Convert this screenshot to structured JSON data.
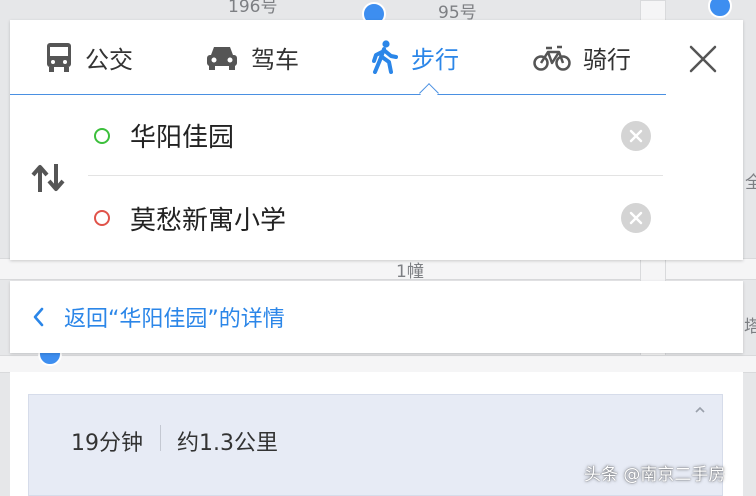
{
  "map": {
    "labels": [
      "196号",
      "95号",
      "1幢",
      "全",
      "塔"
    ]
  },
  "route_card": {
    "tabs": [
      {
        "label": "公交",
        "icon": "bus-icon",
        "active": false
      },
      {
        "label": "驾车",
        "icon": "car-icon",
        "active": false
      },
      {
        "label": "步行",
        "icon": "walk-icon",
        "active": true
      },
      {
        "label": "骑行",
        "icon": "bicycle-icon",
        "active": false
      }
    ],
    "start": {
      "value": "华阳佳园"
    },
    "end": {
      "value": "莫愁新寓小学"
    }
  },
  "back_link": {
    "label": "返回“华阳佳园”的详情"
  },
  "result": {
    "duration": "19分钟",
    "distance": "约1.3公里"
  },
  "watermark": "头条 @南京二手房",
  "colors": {
    "accent": "#2b86e8",
    "start_dot": "#3cbf3c",
    "end_dot": "#e0534a",
    "result_bg": "#e7ebf5"
  }
}
